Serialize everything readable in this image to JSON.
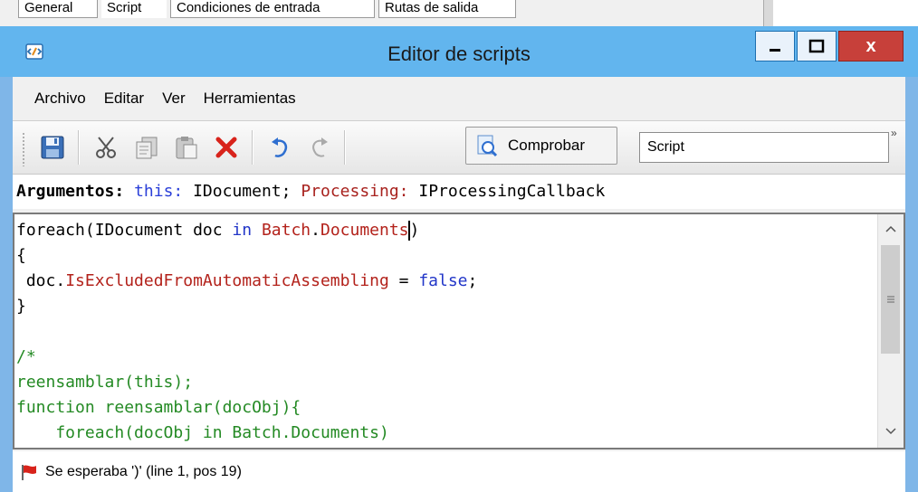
{
  "background_tabs": [
    {
      "label": "General"
    },
    {
      "label": "Script"
    },
    {
      "label": "Condiciones de entrada"
    },
    {
      "label": "Rutas de salida"
    }
  ],
  "window": {
    "title": "Editor de scripts",
    "close_label": "x",
    "accent_color": "#62b5ee",
    "close_color": "#c7403a"
  },
  "menu": {
    "items": [
      "Archivo",
      "Editar",
      "Ver",
      "Herramientas"
    ]
  },
  "toolbar": {
    "buttons": [
      "save-icon",
      "cut-icon",
      "copy-icon",
      "paste-icon",
      "delete-icon",
      "undo-icon",
      "redo-icon"
    ],
    "check_label": "Comprobar",
    "combo_value": "Script",
    "overflow_label": "»"
  },
  "arguments": {
    "label": "Argumentos:",
    "this_name": "this:",
    "this_type": "IDocument;",
    "processing_name": "Processing:",
    "processing_type": "IProcessingCallback"
  },
  "editor": {
    "lines": [
      [
        {
          "t": "foreach(IDocument doc ",
          "c": "black"
        },
        {
          "t": "in",
          "c": "blue"
        },
        {
          "t": " ",
          "c": "black"
        },
        {
          "t": "Batch",
          "c": "red"
        },
        {
          "t": ".",
          "c": "black"
        },
        {
          "t": "Documents",
          "c": "red"
        },
        {
          "t": ")",
          "c": "black",
          "cursor": true
        }
      ],
      [
        {
          "t": "{",
          "c": "black"
        }
      ],
      [
        {
          "t": " doc.",
          "c": "black"
        },
        {
          "t": "IsExcludedFromAutomaticAssembling",
          "c": "red"
        },
        {
          "t": " = ",
          "c": "black"
        },
        {
          "t": "false",
          "c": "blue"
        },
        {
          "t": ";",
          "c": "black"
        }
      ],
      [
        {
          "t": "}",
          "c": "black"
        }
      ],
      [
        {
          "t": "",
          "c": "black"
        }
      ],
      [
        {
          "t": "/*",
          "c": "green"
        }
      ],
      [
        {
          "t": "reensamblar(this);",
          "c": "green"
        }
      ],
      [
        {
          "t": "function reensamblar(docObj){",
          "c": "green"
        }
      ],
      [
        {
          "t": "    foreach(docObj in Batch.Documents)",
          "c": "green"
        }
      ]
    ]
  },
  "status": {
    "message": "Se esperaba ')' (line 1, pos 19)"
  }
}
